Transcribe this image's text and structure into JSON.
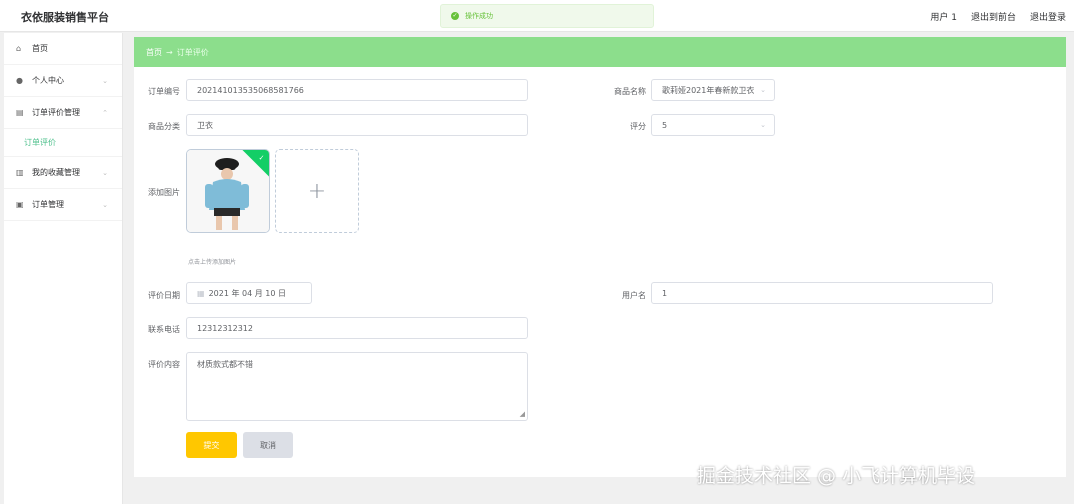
{
  "app": {
    "title": "衣依服装销售平台"
  },
  "toast": {
    "text": "操作成功"
  },
  "header": {
    "links": [
      "用户 1",
      "退出到前台",
      "退出登录"
    ]
  },
  "sidebar": {
    "items": [
      {
        "label": "首页",
        "icon": "home-icon"
      },
      {
        "label": "个人中心",
        "icon": "user-icon"
      },
      {
        "label": "订单评价管理",
        "icon": "briefcase-icon"
      },
      {
        "label": "订单评价",
        "icon": ""
      },
      {
        "label": "我的收藏管理",
        "icon": "chart-icon"
      },
      {
        "label": "订单管理",
        "icon": "image-icon"
      }
    ]
  },
  "breadcrumb": {
    "home": "首页",
    "current": "订单评价"
  },
  "form": {
    "order_no": {
      "label": "订单编号",
      "value": "20214101353506858176​6"
    },
    "product_name": {
      "label": "商品名称",
      "value": "歌莉娅2021年春新款卫衣"
    },
    "category": {
      "label": "商品分类",
      "value": "卫衣"
    },
    "rating": {
      "label": "评分",
      "value": "5"
    },
    "image": {
      "label": "添加图片",
      "tip": "点击上传添加图片"
    },
    "review_date": {
      "label": "评价日期",
      "value": "2021 年 04 月 10 日"
    },
    "username": {
      "label": "用户名",
      "value": "1"
    },
    "phone": {
      "label": "联系电话",
      "value": "12312312312"
    },
    "content": {
      "label": "评价内容",
      "value": "材质款式都不错"
    }
  },
  "buttons": {
    "submit": "提交",
    "cancel": "取消"
  },
  "watermark": "掘金技术社区 @ 小飞计算机毕设",
  "colors": {
    "accent": "#8cde8c",
    "primary_button": "#ffc700",
    "active_menu": "#4fc08d"
  }
}
